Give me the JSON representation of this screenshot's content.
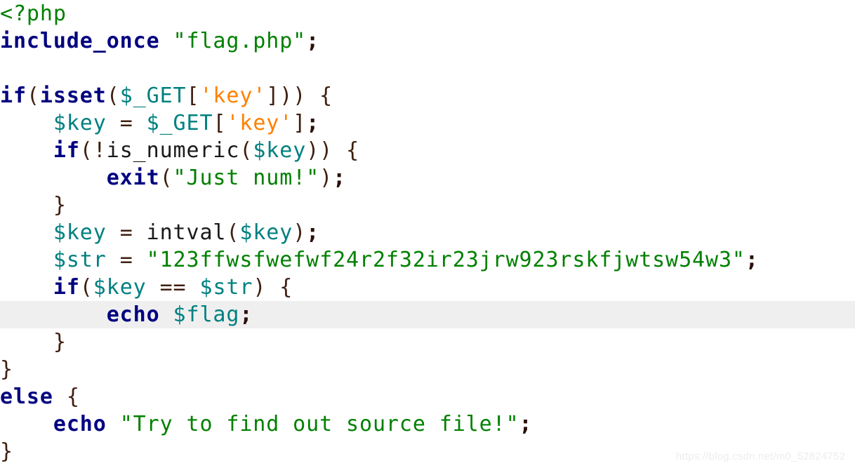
{
  "document": {
    "language": "php",
    "background_color": "#ffffff",
    "highlight_color": "#efefef",
    "watermark": "https://blog.csdn.net/m0_52824752"
  },
  "palette": {
    "keyword": "#000080",
    "variable": "#008080",
    "string": "#008000",
    "single_quoted_string": "#ff8000",
    "punctuation": "#3f1f10",
    "plain": "#1a1a1a",
    "tag": "#008000"
  },
  "code": {
    "lines": [
      {
        "index": 1,
        "text": "<?php",
        "highlighted": false,
        "tokens": [
          {
            "t": "<?php",
            "k": "tag"
          }
        ]
      },
      {
        "index": 2,
        "text": "include_once \"flag.php\";",
        "highlighted": false,
        "tokens": [
          {
            "t": "include_once",
            "k": "keyword"
          },
          {
            "t": " ",
            "k": "plain"
          },
          {
            "t": "\"flag.php\"",
            "k": "string"
          },
          {
            "t": ";",
            "k": "semi"
          }
        ]
      },
      {
        "index": 3,
        "text": "",
        "highlighted": false,
        "tokens": []
      },
      {
        "index": 4,
        "text": "if(isset($_GET['key'])) {",
        "highlighted": false,
        "tokens": [
          {
            "t": "if",
            "k": "keyword"
          },
          {
            "t": "(",
            "k": "punct"
          },
          {
            "t": "isset",
            "k": "keyword"
          },
          {
            "t": "(",
            "k": "punct"
          },
          {
            "t": "$_GET",
            "k": "var"
          },
          {
            "t": "[",
            "k": "punct"
          },
          {
            "t": "'key'",
            "k": "sqstring"
          },
          {
            "t": "]",
            "k": "punct"
          },
          {
            "t": "))",
            "k": "punct"
          },
          {
            "t": " ",
            "k": "plain"
          },
          {
            "t": "{",
            "k": "punct"
          }
        ]
      },
      {
        "index": 5,
        "text": "    $key = $_GET['key'];",
        "highlighted": false,
        "tokens": [
          {
            "t": "    ",
            "k": "plain"
          },
          {
            "t": "$key",
            "k": "var"
          },
          {
            "t": " ",
            "k": "plain"
          },
          {
            "t": "=",
            "k": "punct"
          },
          {
            "t": " ",
            "k": "plain"
          },
          {
            "t": "$_GET",
            "k": "var"
          },
          {
            "t": "[",
            "k": "punct"
          },
          {
            "t": "'key'",
            "k": "sqstring"
          },
          {
            "t": "]",
            "k": "punct"
          },
          {
            "t": ";",
            "k": "semi"
          }
        ]
      },
      {
        "index": 6,
        "text": "    if(!is_numeric($key)) {",
        "highlighted": false,
        "tokens": [
          {
            "t": "    ",
            "k": "plain"
          },
          {
            "t": "if",
            "k": "keyword"
          },
          {
            "t": "(",
            "k": "punct"
          },
          {
            "t": "!",
            "k": "punct"
          },
          {
            "t": "is_numeric",
            "k": "func"
          },
          {
            "t": "(",
            "k": "punct"
          },
          {
            "t": "$key",
            "k": "var"
          },
          {
            "t": "))",
            "k": "punct"
          },
          {
            "t": " ",
            "k": "plain"
          },
          {
            "t": "{",
            "k": "punct"
          }
        ]
      },
      {
        "index": 7,
        "text": "        exit(\"Just num!\");",
        "highlighted": false,
        "tokens": [
          {
            "t": "        ",
            "k": "plain"
          },
          {
            "t": "exit",
            "k": "keyword"
          },
          {
            "t": "(",
            "k": "punct"
          },
          {
            "t": "\"Just num!\"",
            "k": "string"
          },
          {
            "t": ")",
            "k": "punct"
          },
          {
            "t": ";",
            "k": "semi"
          }
        ]
      },
      {
        "index": 8,
        "text": "    }",
        "highlighted": false,
        "tokens": [
          {
            "t": "    ",
            "k": "plain"
          },
          {
            "t": "}",
            "k": "punct"
          }
        ]
      },
      {
        "index": 9,
        "text": "    $key = intval($key);",
        "highlighted": false,
        "tokens": [
          {
            "t": "    ",
            "k": "plain"
          },
          {
            "t": "$key",
            "k": "var"
          },
          {
            "t": " ",
            "k": "plain"
          },
          {
            "t": "=",
            "k": "punct"
          },
          {
            "t": " ",
            "k": "plain"
          },
          {
            "t": "intval",
            "k": "func"
          },
          {
            "t": "(",
            "k": "punct"
          },
          {
            "t": "$key",
            "k": "var"
          },
          {
            "t": ")",
            "k": "punct"
          },
          {
            "t": ";",
            "k": "semi"
          }
        ]
      },
      {
        "index": 10,
        "text": "    $str = \"123ffwsfwefwf24r2f32ir23jrw923rskfjwtsw54w3\";",
        "highlighted": false,
        "tokens": [
          {
            "t": "    ",
            "k": "plain"
          },
          {
            "t": "$str",
            "k": "var"
          },
          {
            "t": " ",
            "k": "plain"
          },
          {
            "t": "=",
            "k": "punct"
          },
          {
            "t": " ",
            "k": "plain"
          },
          {
            "t": "\"123ffwsfwefwf24r2f32ir23jrw923rskfjwtsw54w3\"",
            "k": "string"
          },
          {
            "t": ";",
            "k": "semi"
          }
        ]
      },
      {
        "index": 11,
        "text": "    if($key == $str) {",
        "highlighted": false,
        "tokens": [
          {
            "t": "    ",
            "k": "plain"
          },
          {
            "t": "if",
            "k": "keyword"
          },
          {
            "t": "(",
            "k": "punct"
          },
          {
            "t": "$key",
            "k": "var"
          },
          {
            "t": " ",
            "k": "plain"
          },
          {
            "t": "==",
            "k": "punct"
          },
          {
            "t": " ",
            "k": "plain"
          },
          {
            "t": "$str",
            "k": "var"
          },
          {
            "t": ")",
            "k": "punct"
          },
          {
            "t": " ",
            "k": "plain"
          },
          {
            "t": "{",
            "k": "punct"
          }
        ]
      },
      {
        "index": 12,
        "text": "        echo $flag;",
        "highlighted": true,
        "tokens": [
          {
            "t": "        ",
            "k": "plain"
          },
          {
            "t": "echo",
            "k": "keyword"
          },
          {
            "t": " ",
            "k": "plain"
          },
          {
            "t": "$flag",
            "k": "var"
          },
          {
            "t": ";",
            "k": "semi"
          }
        ]
      },
      {
        "index": 13,
        "text": "    }",
        "highlighted": false,
        "tokens": [
          {
            "t": "    ",
            "k": "plain"
          },
          {
            "t": "}",
            "k": "punct"
          }
        ]
      },
      {
        "index": 14,
        "text": "}",
        "highlighted": false,
        "tokens": [
          {
            "t": "}",
            "k": "punct"
          }
        ]
      },
      {
        "index": 15,
        "text": "else {",
        "highlighted": false,
        "tokens": [
          {
            "t": "else",
            "k": "keyword"
          },
          {
            "t": " ",
            "k": "plain"
          },
          {
            "t": "{",
            "k": "punct"
          }
        ]
      },
      {
        "index": 16,
        "text": "    echo \"Try to find out source file!\";",
        "highlighted": false,
        "tokens": [
          {
            "t": "    ",
            "k": "plain"
          },
          {
            "t": "echo",
            "k": "keyword"
          },
          {
            "t": " ",
            "k": "plain"
          },
          {
            "t": "\"Try to find out source file!\"",
            "k": "string"
          },
          {
            "t": ";",
            "k": "semi"
          }
        ]
      },
      {
        "index": 17,
        "text": "}",
        "highlighted": false,
        "tokens": [
          {
            "t": "}",
            "k": "punct"
          }
        ]
      }
    ]
  }
}
